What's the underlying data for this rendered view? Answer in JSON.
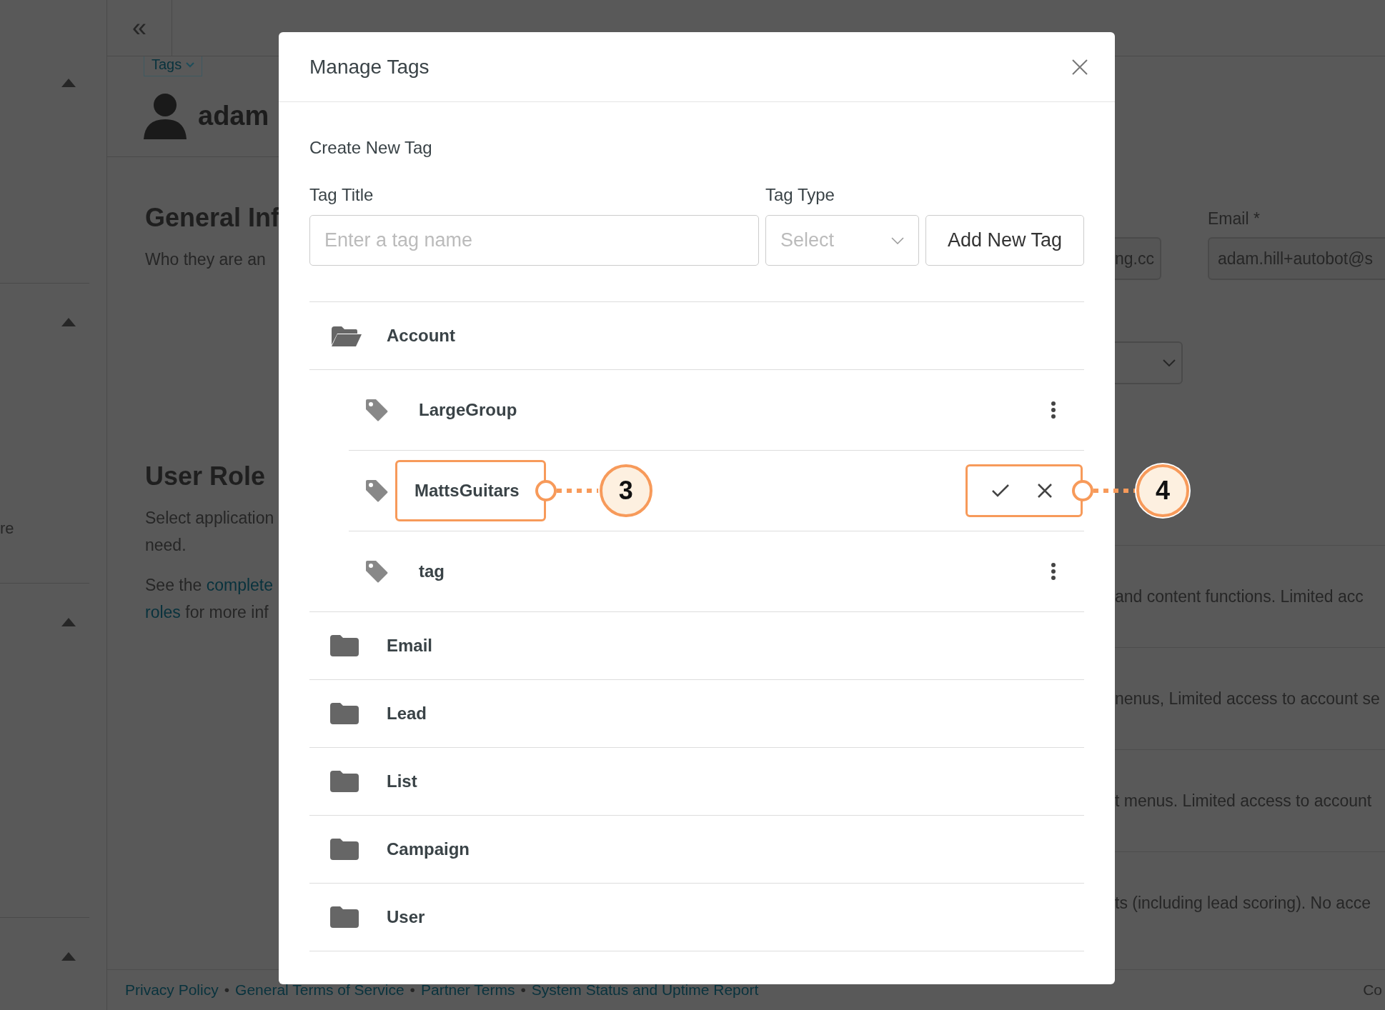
{
  "background": {
    "sidebar": [
      {
        "expanded": true
      },
      {
        "expanded": true,
        "text": "re"
      },
      {
        "expanded": true
      },
      {
        "expanded": true
      }
    ],
    "collapse_icon": "«",
    "tags_button": "Tags",
    "user_name": "adam",
    "general": {
      "heading": "General Inf",
      "text": "Who they are an"
    },
    "role": {
      "heading": "User Role",
      "text": "Select application",
      "text_2": "need.",
      "see_before": "See the ",
      "see_link": "complete",
      "see_link_2": "roles",
      "see_after": " for more inf"
    },
    "right": {
      "field_fragment": "ng.cc",
      "email_label": "Email *",
      "email_value": "adam.hill+autobot@s",
      "role_texts": [
        "and content functions. Limited acc",
        "nenus, Limited access to account se",
        "t menus. Limited access to account",
        "ts (including lead scoring). No acce"
      ]
    },
    "footer": {
      "links": [
        "Privacy Policy",
        "General Terms of Service",
        "Partner Terms",
        "System Status and Uptime Report"
      ],
      "separator": "•",
      "fragment": "Co"
    }
  },
  "modal": {
    "title": "Manage Tags",
    "section_title": "Create New Tag",
    "title_label": "Tag Title",
    "title_placeholder": "Enter a tag name",
    "type_label": "Tag Type",
    "type_placeholder": "Select",
    "add_button": "Add New Tag",
    "folders": [
      {
        "name": "Account",
        "expanded": true,
        "children": [
          {
            "name": "LargeGroup",
            "editing": false
          },
          {
            "name": "MattsGuitars",
            "editing": true,
            "name_callout": "3",
            "actions_callout": "4"
          },
          {
            "name": "tag",
            "editing": false
          }
        ]
      },
      {
        "name": "Email",
        "expanded": false
      },
      {
        "name": "Lead",
        "expanded": false
      },
      {
        "name": "List",
        "expanded": false
      },
      {
        "name": "Campaign",
        "expanded": false
      },
      {
        "name": "User",
        "expanded": false
      }
    ]
  }
}
